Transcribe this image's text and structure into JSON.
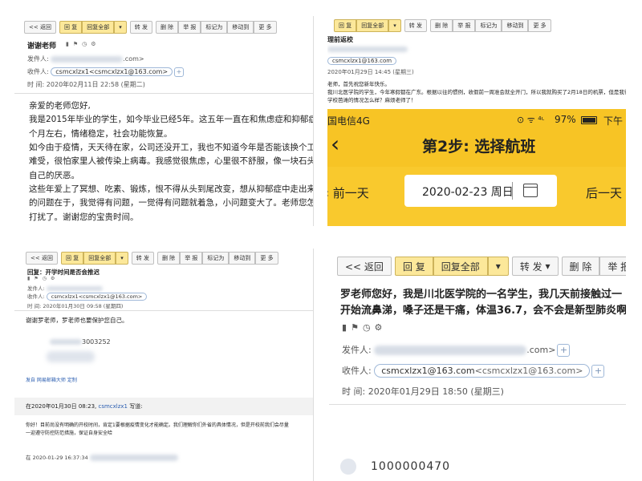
{
  "toolbar": {
    "back": "<< 返回",
    "reply": "回 复",
    "reply_all": "回复全部",
    "forward": "转 发",
    "delete": "删 除",
    "report": "举 报",
    "mark": "标记为",
    "move": "移动到",
    "more": "更 多",
    "arrow": "▾"
  },
  "labels": {
    "sender": "发件人:",
    "recipient": "收件人:",
    "time": "时  间:",
    "time_big": "时  间:"
  },
  "email1": {
    "subject": "谢谢老师",
    "recipient_email": "csmcxlzx1<csmcxlzx1@163.com>",
    "sender_suffix": ".com>",
    "time": "2020年02月11日 22:58 (星期二)",
    "lines": [
      "亲爱的老师您好,",
      "  我是2015年毕业的学生，如今毕业已经5年。这五年一直在和焦虑症和抑郁症对",
      "个月左右，情绪稳定，社会功能恢复。",
      "  如今由于疫情，天天待在家，公司还没开工，我也不知道今年是否能该换个工作",
      "难受，很怕家里人被传染上病毒。我感觉很焦虑，心里很不舒服，像一块石头压",
      "自己的厌恶。",
      "  这些年爱上了冥想、吃素、锻炼，恨不得从头到尾改变，想从抑郁症中走出来",
      "的问题在于，我觉得有问题，一觉得有问题就着急，小问题变大了。老师您怎么",
      "  打扰了。谢谢您的宝贵时间。"
    ]
  },
  "email2": {
    "subject": "理前返校",
    "recipient_email": "csmcxlzx1@163.com",
    "time": "2020年01月29日 14:45 (星期三)",
    "lines": [
      "老师，首先祝您新年快乐。",
      "我川北医学院的学生，今年寒假都在广东。根据以往的惯例，收假前一周准会就全开门，所以我就购买了2月18日的机票，但是我得",
      "学校芭滩的情况怎么样？麻烦老师了！"
    ]
  },
  "phone": {
    "carrier": "国电信4G",
    "status_icons": "⊙ ᯤ ⁴ᶫ",
    "battery": "97%",
    "time_prefix": "下午",
    "back_icon": "‹",
    "step_title": "第2步: 选择航班",
    "prev_day": "前一天",
    "next_day": "后一天",
    "date": "2020-02-23 周日"
  },
  "email3": {
    "subject": "回复：开学时间是否会推迟",
    "recipient_email": "csmcxlzx1<csmcxlzx1@163.com>",
    "time": "2020年01月30日 09:58 (星期四)",
    "body": "谢谢罗老师，罗老师也要保护您自己。",
    "phone_fragment": "3003252",
    "mail_tag": "发自 网易邮箱大师 定制",
    "quote_head": "在2020年01月30日 08:23, ",
    "quote_user": "csmcxlzx1",
    "quote_suffix": " 写道:",
    "quote_lines": [
      "你好！目前尚没有明确的开校时间，肯定1要根据疫情变化才能确定。我们理解你们外省的具体情况，但是开校前我们会尽量",
      "一迎遵守防控防范措施，保证自身安全哈"
    ],
    "footer": "在 2020-01-29 16:37:34"
  },
  "email4": {
    "line1": "罗老师您好，我是川北医学院的一名学生，我几天前接触过一",
    "line2": "开始流鼻涕，嗓子还是干痛，体温36.7，会不会是新型肺炎啊",
    "sender_suffix": ".com>",
    "recipient_email": "csmcxlzx1@163.com",
    "recipient_alias": "<csmcxlzx1@163.com>",
    "time": "2020年01月29日 18:50 (星期三)",
    "bottom_fragment": "1000000470"
  }
}
